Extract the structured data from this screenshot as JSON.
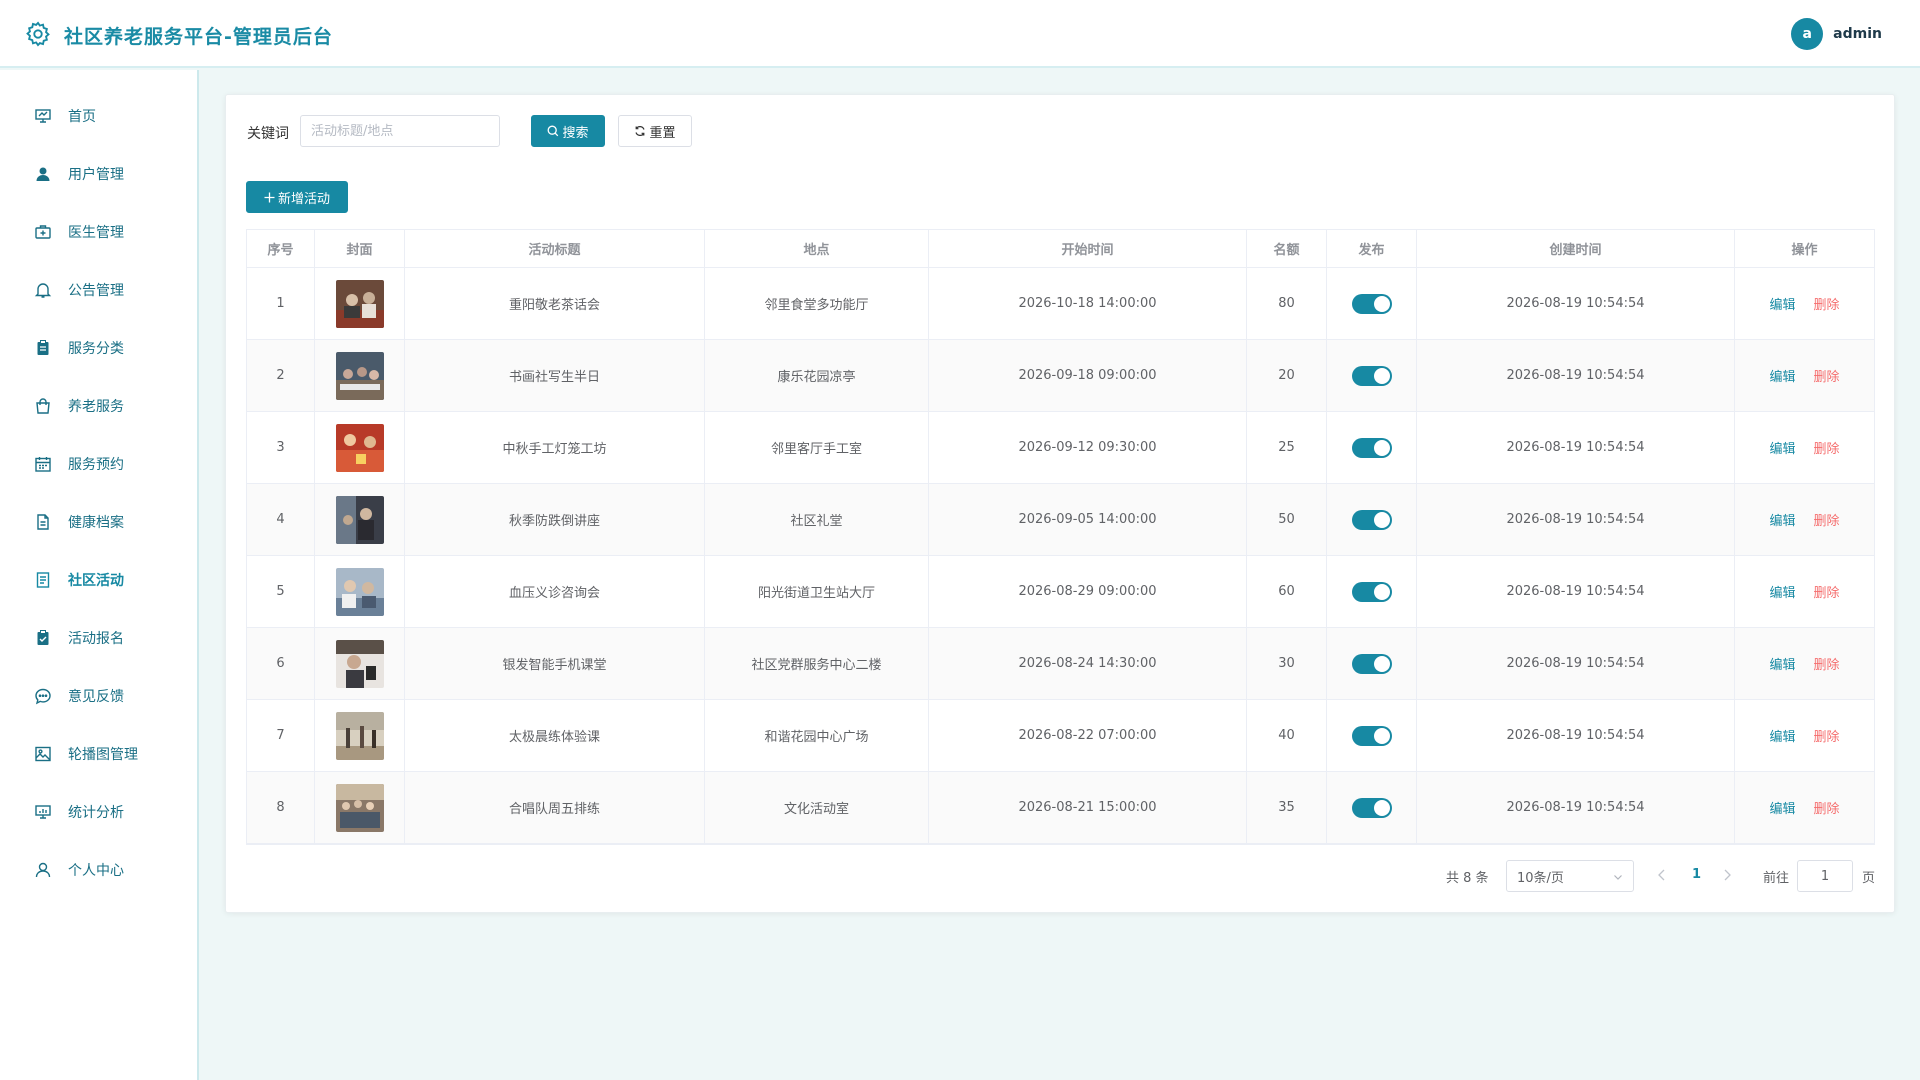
{
  "header": {
    "title": "社区养老服务平台-管理员后台",
    "avatar_letter": "a",
    "username": "admin"
  },
  "sidebar": {
    "items": [
      {
        "label": "首页",
        "icon": "dashboard-icon"
      },
      {
        "label": "用户管理",
        "icon": "user-icon"
      },
      {
        "label": "医生管理",
        "icon": "first-aid-kit-icon"
      },
      {
        "label": "公告管理",
        "icon": "bell-icon"
      },
      {
        "label": "服务分类",
        "icon": "clipboard-icon"
      },
      {
        "label": "养老服务",
        "icon": "shopping-bag-icon"
      },
      {
        "label": "服务预约",
        "icon": "calendar-icon"
      },
      {
        "label": "健康档案",
        "icon": "document-icon"
      },
      {
        "label": "社区活动",
        "icon": "tickets-icon",
        "active": true
      },
      {
        "label": "活动报名",
        "icon": "checked-clipboard-icon"
      },
      {
        "label": "意见反馈",
        "icon": "chat-bubble-icon"
      },
      {
        "label": "轮播图管理",
        "icon": "picture-icon"
      },
      {
        "label": "统计分析",
        "icon": "monitor-chart-icon"
      },
      {
        "label": "个人中心",
        "icon": "person-outline-icon"
      }
    ]
  },
  "search": {
    "label": "关键词",
    "placeholder": "活动标题/地点",
    "value": "",
    "search_label": "搜索",
    "reset_label": "重置",
    "add_label": "新增活动"
  },
  "table": {
    "columns": [
      "序号",
      "封面",
      "活动标题",
      "地点",
      "开始时间",
      "名额",
      "发布",
      "创建时间",
      "操作"
    ],
    "edit_label": "编辑",
    "delete_label": "删除",
    "rows": [
      {
        "seq": "1",
        "title": "重阳敬老茶话会",
        "place": "邻里食堂多功能厅",
        "start": "2026-10-18 14:00:00",
        "quota": "80",
        "published": true,
        "created": "2026-08-19 10:54:54"
      },
      {
        "seq": "2",
        "title": "书画社写生半日",
        "place": "康乐花园凉亭",
        "start": "2026-09-18 09:00:00",
        "quota": "20",
        "published": true,
        "created": "2026-08-19 10:54:54"
      },
      {
        "seq": "3",
        "title": "中秋手工灯笼工坊",
        "place": "邻里客厅手工室",
        "start": "2026-09-12 09:30:00",
        "quota": "25",
        "published": true,
        "created": "2026-08-19 10:54:54"
      },
      {
        "seq": "4",
        "title": "秋季防跌倒讲座",
        "place": "社区礼堂",
        "start": "2026-09-05 14:00:00",
        "quota": "50",
        "published": true,
        "created": "2026-08-19 10:54:54"
      },
      {
        "seq": "5",
        "title": "血压义诊咨询会",
        "place": "阳光街道卫生站大厅",
        "start": "2026-08-29 09:00:00",
        "quota": "60",
        "published": true,
        "created": "2026-08-19 10:54:54"
      },
      {
        "seq": "6",
        "title": "银发智能手机课堂",
        "place": "社区党群服务中心二楼",
        "start": "2026-08-24 14:30:00",
        "quota": "30",
        "published": true,
        "created": "2026-08-19 10:54:54"
      },
      {
        "seq": "7",
        "title": "太极晨练体验课",
        "place": "和谐花园中心广场",
        "start": "2026-08-22 07:00:00",
        "quota": "40",
        "published": true,
        "created": "2026-08-19 10:54:54"
      },
      {
        "seq": "8",
        "title": "合唱队周五排练",
        "place": "文化活动室",
        "start": "2026-08-21 15:00:00",
        "quota": "35",
        "published": true,
        "created": "2026-08-19 10:54:54"
      }
    ]
  },
  "pagination": {
    "total_text": "共 8 条",
    "page_size": "10条/页",
    "current_page": "1",
    "goto_label": "前往",
    "goto_value": "1",
    "page_suffix": "页"
  },
  "colors": {
    "primary": "#1789a3",
    "danger": "#f56c6c",
    "background": "#eef7f7"
  }
}
